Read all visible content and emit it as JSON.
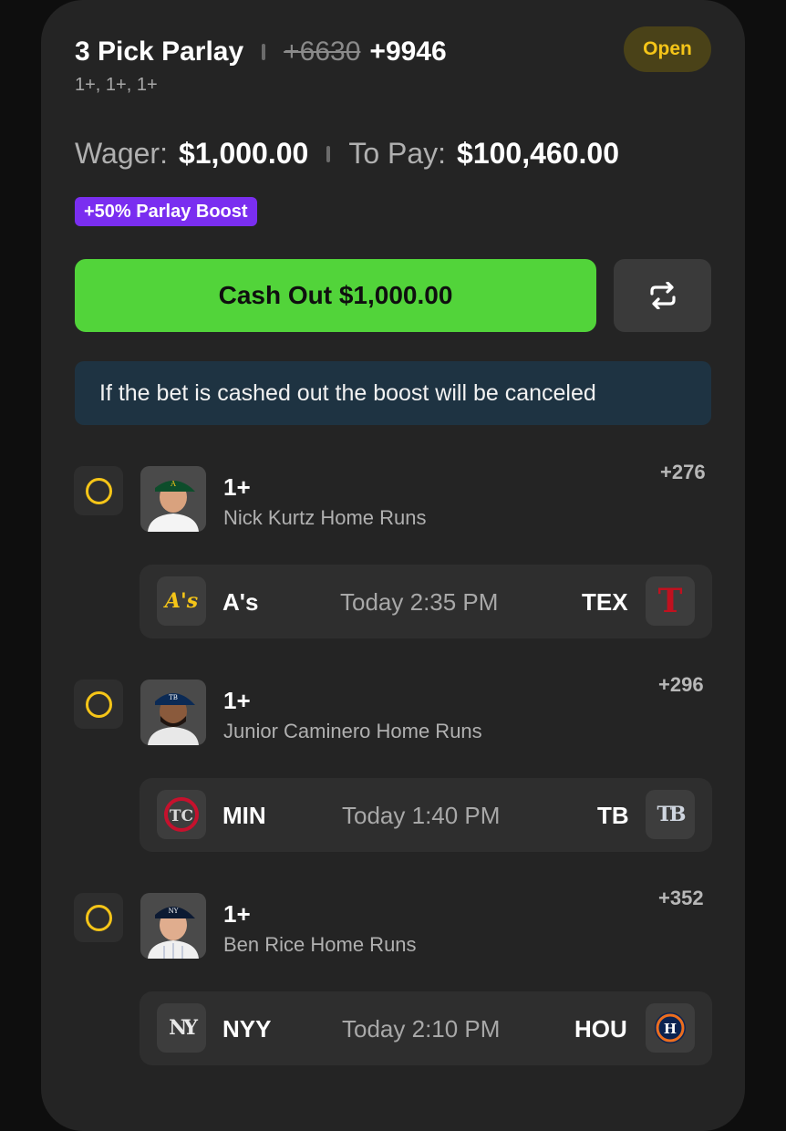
{
  "header": {
    "title": "3 Pick Parlay",
    "old_odds": "+6630",
    "new_odds": "+9946",
    "lines": "1+, 1+, 1+",
    "status": "Open"
  },
  "wager": {
    "wager_label": "Wager:",
    "wager_value": "$1,000.00",
    "pay_label": "To Pay:",
    "pay_value": "$100,460.00"
  },
  "boost_badge": "+50% Parlay Boost",
  "cashout_label": "Cash Out $1,000.00",
  "notice": "If the bet is cashed out the boost will be canceled",
  "picks": [
    {
      "line": "1+",
      "description": "Nick Kurtz Home Runs",
      "odds": "+276",
      "away_team": "A's",
      "game_time": "Today 2:35 PM",
      "home_team": "TEX"
    },
    {
      "line": "1+",
      "description": "Junior Caminero Home Runs",
      "odds": "+296",
      "away_team": "MIN",
      "game_time": "Today 1:40 PM",
      "home_team": "TB"
    },
    {
      "line": "1+",
      "description": "Ben Rice Home Runs",
      "odds": "+352",
      "away_team": "NYY",
      "game_time": "Today 2:10 PM",
      "home_team": "HOU"
    }
  ],
  "logo_text": {
    "athletics": "A's",
    "rangers": "T",
    "twins": "TC",
    "rays": "TB",
    "yankees": "NY",
    "astros": "H"
  },
  "colors": {
    "accent_green": "#52d43a",
    "status_yellow": "#f5c518",
    "boost_purple": "#7a2ef0",
    "notice_bg": "#1e3342"
  }
}
